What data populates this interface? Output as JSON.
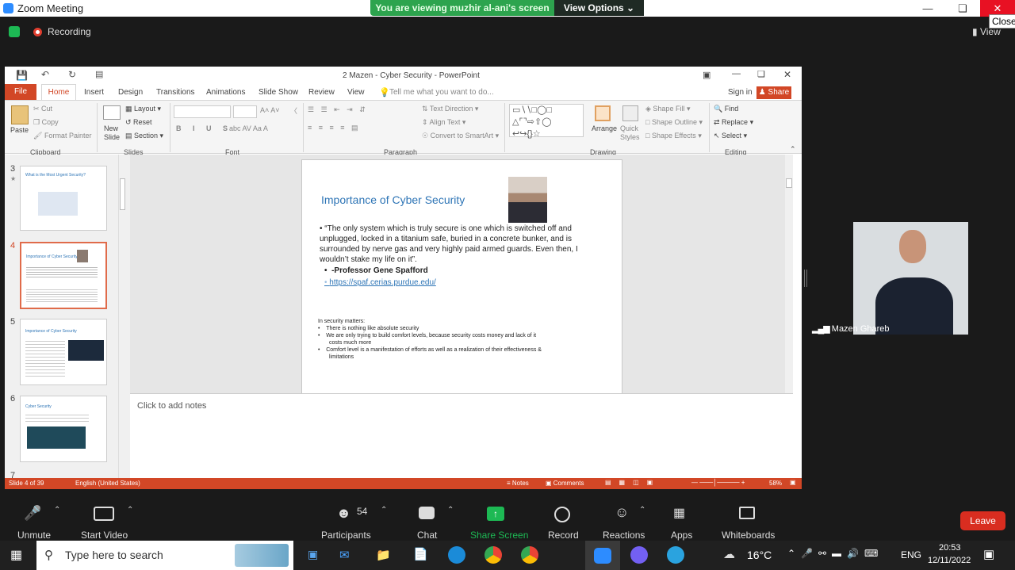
{
  "window": {
    "title": "Zoom Meeting",
    "close_tooltip": "Close"
  },
  "share_banner": {
    "message": "You are viewing muzhir al-ani's screen",
    "options_label": "View Options"
  },
  "recording": {
    "label": "Recording"
  },
  "view_label": "View",
  "ppt": {
    "title": "2 Mazen - Cyber Security - PowerPoint",
    "tabs": [
      "File",
      "Home",
      "Insert",
      "Design",
      "Transitions",
      "Animations",
      "Slide Show",
      "Review",
      "View"
    ],
    "tell_me": "Tell me what you want to do...",
    "sign_in": "Sign in",
    "share": "Share",
    "ribbon": {
      "clipboard": {
        "paste": "Paste",
        "cut": "Cut",
        "copy": "Copy",
        "format_painter": "Format Painter",
        "group": "Clipboard"
      },
      "slides": {
        "new_slide": "New Slide",
        "layout": "Layout",
        "reset": "Reset",
        "section": "Section",
        "group": "Slides"
      },
      "font": {
        "group": "Font"
      },
      "paragraph": {
        "text_direction": "Text Direction",
        "align_text": "Align Text",
        "convert": "Convert to SmartArt",
        "group": "Paragraph"
      },
      "drawing": {
        "arrange": "Arrange",
        "quick_styles": "Quick Styles",
        "shape_fill": "Shape Fill",
        "shape_outline": "Shape Outline",
        "shape_effects": "Shape Effects",
        "group": "Drawing"
      },
      "editing": {
        "find": "Find",
        "replace": "Replace",
        "select": "Select",
        "group": "Editing"
      }
    },
    "thumbnails": [
      {
        "num": "3",
        "caption": "What is the Most Urgent Security?"
      },
      {
        "num": "4",
        "caption": "Importance of Cyber Security"
      },
      {
        "num": "5",
        "caption": "Importance of Cyber Security"
      },
      {
        "num": "6",
        "caption": "Cyber Security"
      },
      {
        "num": "7",
        "caption": ""
      }
    ],
    "slide": {
      "title": "Importance of Cyber Security",
      "quote": "“The only system which is truly secure is one which is switched  off and unplugged, locked in a titanium safe, buried in a  concrete bunker, and is surrounded by nerve gas and very  highly paid armed guards. Even then, I wouldn’t stake my life  on it”.",
      "author": "-Professor Gene Spafford",
      "link": "https://spaf.cerias.purdue.edu/",
      "matters_heading": "In security matters:",
      "matters": [
        "There is nothing like absolute security",
        "We are only trying to build comfort levels, because security costs money and  lack of it costs much more",
        "Comfort level is a manifestation of efforts as well as a realization of their effectiveness & limitations"
      ]
    },
    "notes_placeholder": "Click to add notes",
    "status": {
      "slide": "Slide 4 of 39",
      "language": "English (United States)",
      "notes": "Notes",
      "comments": "Comments",
      "zoom": "58%"
    }
  },
  "participant": {
    "name": "Mazen Ghareb"
  },
  "toolbar": {
    "unmute": "Unmute",
    "start_video": "Start Video",
    "participants": "Participants",
    "participants_count": "54",
    "chat": "Chat",
    "share_screen": "Share Screen",
    "record": "Record",
    "reactions": "Reactions",
    "apps": "Apps",
    "whiteboards": "Whiteboards",
    "leave": "Leave"
  },
  "taskbar": {
    "search_placeholder": "Type here to search",
    "temperature": "16°C",
    "lang": "ENG",
    "time": "20:53",
    "date": "12/11/2022"
  },
  "colors": {
    "accent_ppt": "#d24726",
    "zoom_green": "#2da44e",
    "leave_red": "#d92d20",
    "share_green": "#1db954"
  }
}
